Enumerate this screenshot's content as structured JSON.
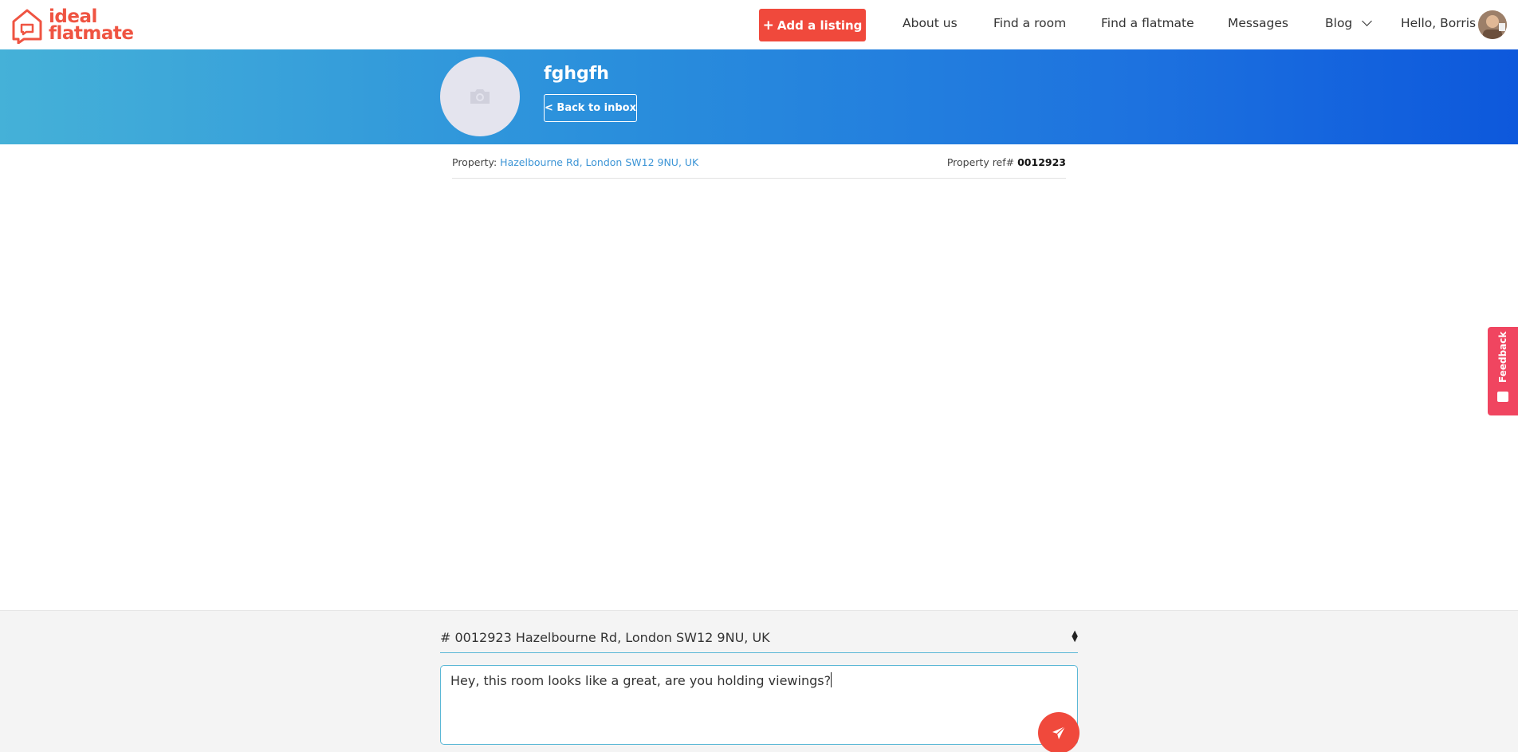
{
  "brand": {
    "line1": "ideal",
    "line2": "flatmate",
    "color": "#ef5442"
  },
  "nav": {
    "add_listing_label": "Add a listing",
    "about_label": "About us",
    "find_room_label": "Find a room",
    "find_flatmate_label": "Find a flatmate",
    "messages_label": "Messages",
    "blog_label": "Blog",
    "greeting": "Hello, Borris"
  },
  "conversation": {
    "name": "fghgfh",
    "back_label": "< Back to inbox"
  },
  "property": {
    "label": "Property: ",
    "address": "Hazelbourne Rd, London SW12 9NU, UK",
    "ref_label": "Property ref# ",
    "ref_value": "0012923"
  },
  "feedback": {
    "label": "Feedback"
  },
  "composer": {
    "selected_property": "# 0012923 Hazelbourne Rd, London SW12 9NU, UK",
    "message_text": "Hey, this room looks like a great, are you holding viewings?"
  },
  "colors": {
    "accent_red": "#f0493c",
    "hero_start": "#45b1d8",
    "hero_end": "#0d58dc",
    "link_blue": "#3d95d6",
    "feedback_pink": "#f04560"
  }
}
